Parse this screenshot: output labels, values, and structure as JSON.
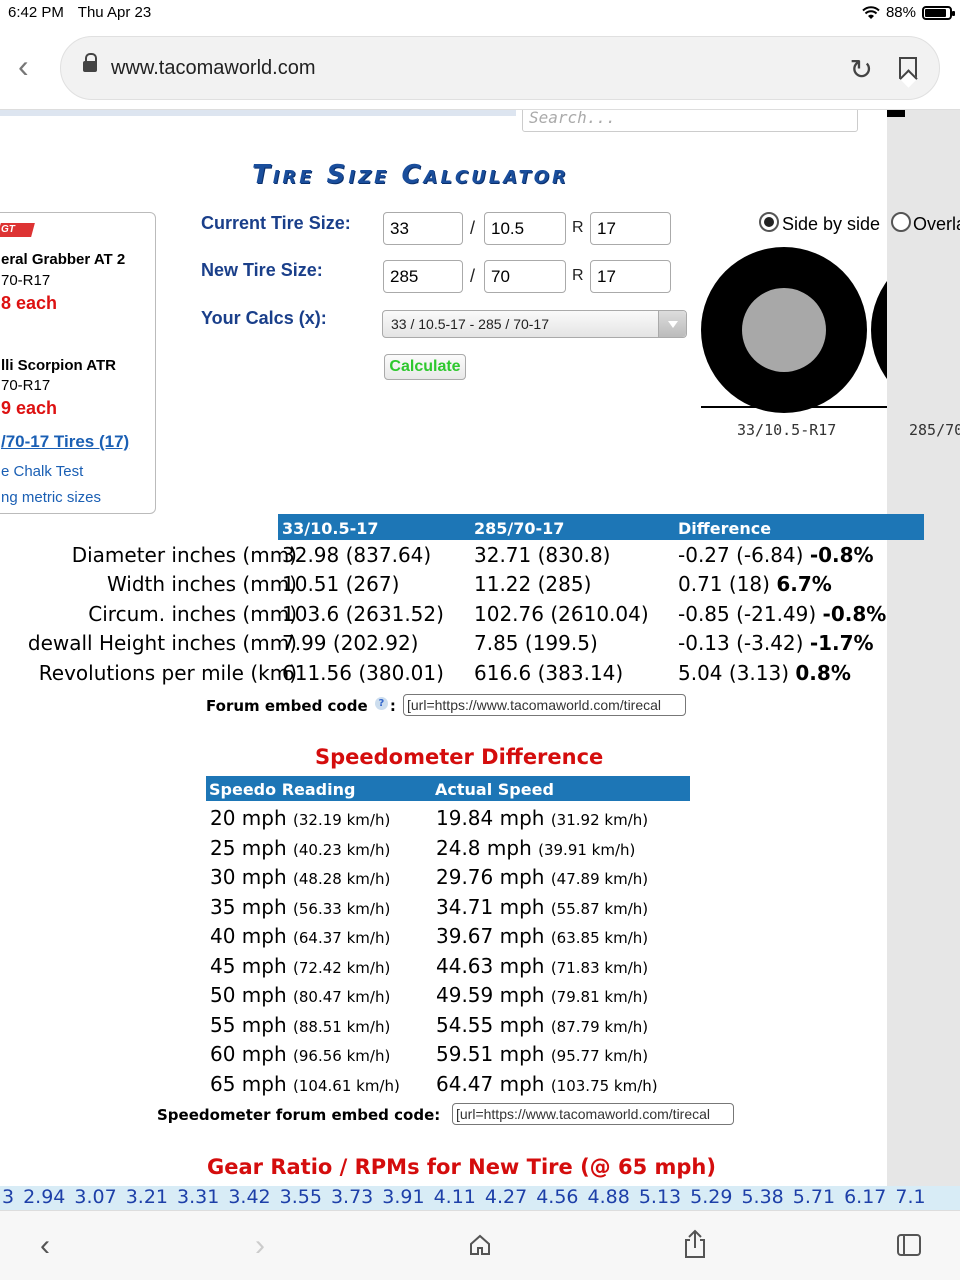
{
  "status": {
    "time": "6:42 PM",
    "date": "Thu Apr 23",
    "battery": "88%",
    "battery_level": 0.88
  },
  "browser": {
    "url": "www.tacomaworld.com"
  },
  "page": {
    "search_placeholder": "Search...",
    "title": "Tire Size Calculator",
    "ad": {
      "logo": "GT",
      "item1_name": "eral Grabber AT 2",
      "item1_size": "70-R17",
      "item1_price": "8 each",
      "item2_name": "lli Scorpion ATR",
      "item2_size": "70-R17",
      "item2_price": "9 each",
      "tires_link": "/70-17 Tires (17)",
      "chalk_link": "e Chalk Test",
      "metric_link": "ng metric sizes"
    },
    "form": {
      "current_label": "Current Tire Size:",
      "new_label": "New Tire Size:",
      "calcs_label": "Your Calcs (x):",
      "current": {
        "a": "33",
        "b": "10.5",
        "c": "17"
      },
      "new": {
        "a": "285",
        "b": "70",
        "c": "17"
      },
      "slash": "/",
      "r": "R",
      "calcs_value": "33 / 10.5-17 - 285 / 70-17",
      "calculate_label": "Calculate"
    },
    "view": {
      "side_label": "Side by side",
      "overlay_label": "Overla",
      "tire1_label": "33/10.5-R17",
      "tire2_label": "285/70"
    },
    "results": {
      "headers": [
        "33/10.5-17",
        "285/70-17",
        "Difference"
      ],
      "rows": [
        {
          "label": "Diameter inches (mm)",
          "a": "32.98 (837.64)",
          "b": "32.71 (830.8)",
          "diff": "-0.27 (-6.84)",
          "pct": "-0.8%"
        },
        {
          "label": "Width inches (mm)",
          "a": "10.51 (267)",
          "b": "11.22 (285)",
          "diff": "0.71 (18)",
          "pct": "6.7%"
        },
        {
          "label": "Circum. inches (mm)",
          "a": "103.6 (2631.52)",
          "b": "102.76 (2610.04)",
          "diff": "-0.85 (-21.49)",
          "pct": "-0.8%"
        },
        {
          "label": "dewall Height inches (mm)",
          "a": "7.99 (202.92)",
          "b": "7.85 (199.5)",
          "diff": "-0.13 (-3.42)",
          "pct": "-1.7%"
        },
        {
          "label": "Revolutions per mile (km)",
          "a": "611.56 (380.01)",
          "b": "616.6 (383.14)",
          "diff": "5.04 (3.13)",
          "pct": "0.8%"
        }
      ],
      "embed_label": "Forum embed code",
      "embed_help": "?",
      "embed_colon": ":",
      "embed_value": "[url=https://www.tacomaworld.com/tirecal"
    },
    "speedo": {
      "title": "Speedometer Difference",
      "headers": [
        "Speedo Reading",
        "Actual Speed"
      ],
      "rows": [
        {
          "r": "20 mph",
          "rk": "(32.19 km/h)",
          "a": "19.84 mph",
          "ak": "(31.92 km/h)"
        },
        {
          "r": "25 mph",
          "rk": "(40.23 km/h)",
          "a": "24.8 mph",
          "ak": "(39.91 km/h)"
        },
        {
          "r": "30 mph",
          "rk": "(48.28 km/h)",
          "a": "29.76 mph",
          "ak": "(47.89 km/h)"
        },
        {
          "r": "35 mph",
          "rk": "(56.33 km/h)",
          "a": "34.71 mph",
          "ak": "(55.87 km/h)"
        },
        {
          "r": "40 mph",
          "rk": "(64.37 km/h)",
          "a": "39.67 mph",
          "ak": "(63.85 km/h)"
        },
        {
          "r": "45 mph",
          "rk": "(72.42 km/h)",
          "a": "44.63 mph",
          "ak": "(71.83 km/h)"
        },
        {
          "r": "50 mph",
          "rk": "(80.47 km/h)",
          "a": "49.59 mph",
          "ak": "(79.81 km/h)"
        },
        {
          "r": "55 mph",
          "rk": "(88.51 km/h)",
          "a": "54.55 mph",
          "ak": "(87.79 km/h)"
        },
        {
          "r": "60 mph",
          "rk": "(96.56 km/h)",
          "a": "59.51 mph",
          "ak": "(95.77 km/h)"
        },
        {
          "r": "65 mph",
          "rk": "(104.61 km/h)",
          "a": "64.47 mph",
          "ak": "(103.75 km/h)"
        }
      ],
      "embed_label": "Speedometer forum embed code:",
      "embed_value": "[url=https://www.tacomaworld.com/tirecal"
    },
    "gear": {
      "title": "Gear Ratio / RPMs for New Tire (@ 65 mph)",
      "ratios": [
        "3",
        "2.94",
        "3.07",
        "3.21",
        "3.31",
        "3.42",
        "3.55",
        "3.73",
        "3.91",
        "4.11",
        "4.27",
        "4.56",
        "4.88",
        "5.13",
        "5.29",
        "5.38",
        "5.71",
        "6.17",
        "7.1"
      ]
    }
  },
  "icons": {
    "back": "chevron-left-icon",
    "forward": "chevron-right-icon",
    "home": "home-icon",
    "share": "share-icon",
    "tabs": "tabs-icon",
    "reload": "reload-icon",
    "bookmark": "bookmark-icon",
    "lock": "lock-icon"
  }
}
